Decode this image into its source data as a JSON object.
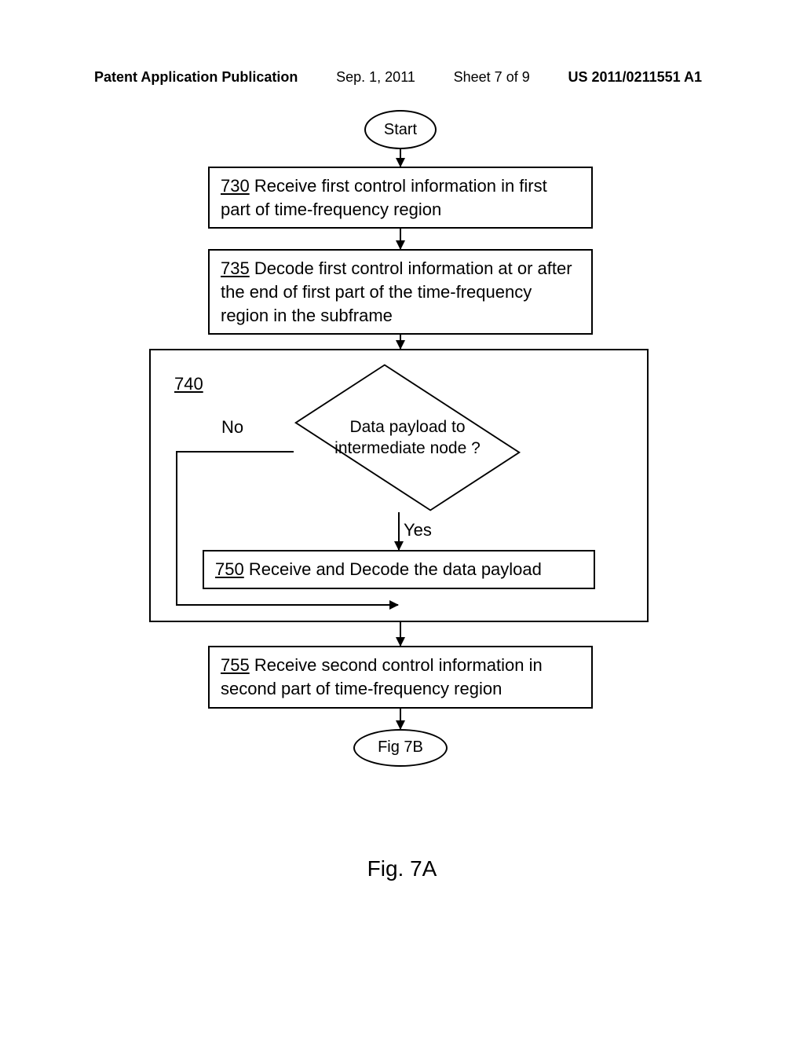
{
  "header": {
    "publication_label": "Patent Application Publication",
    "date": "Sep. 1, 2011",
    "sheet": "Sheet 7 of 9",
    "pub_number": "US 2011/0211551 A1"
  },
  "flowchart": {
    "start": "Start",
    "step_730": {
      "ref": "730",
      "text": "Receive first control information in first part of time-frequency region"
    },
    "step_735": {
      "ref": "735",
      "text": "Decode first control information at or after the end of first part of the time-frequency region in the subframe"
    },
    "step_740": {
      "ref": "740",
      "question": "Data payload to intermediate node ?",
      "no": "No",
      "yes": "Yes"
    },
    "step_750": {
      "ref": "750",
      "text": "Receive and Decode the data payload"
    },
    "step_755": {
      "ref": "755",
      "text": "Receive second control information in second part of time-frequency region"
    },
    "end": "Fig 7B"
  },
  "caption": "Fig. 7A"
}
